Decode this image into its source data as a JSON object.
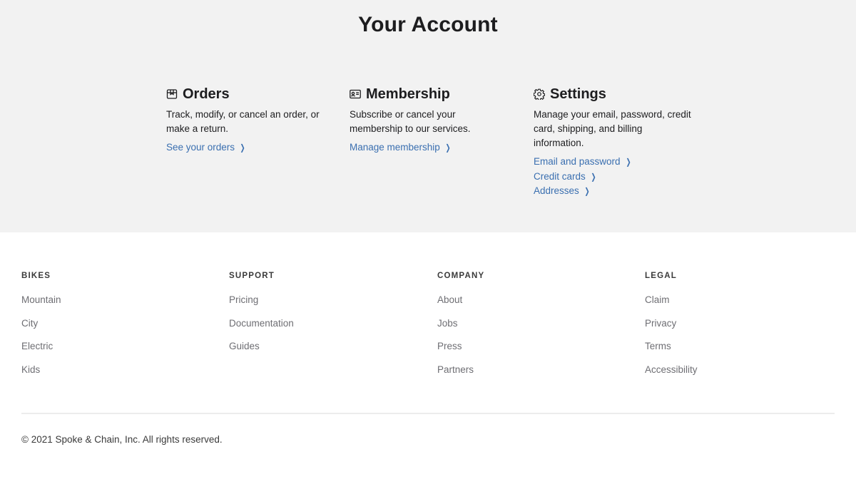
{
  "page": {
    "title": "Your Account"
  },
  "cards": [
    {
      "title": "Orders",
      "icon": "package-icon",
      "description": "Track, modify, or cancel an order, or make a return.",
      "links": [
        "See your orders"
      ]
    },
    {
      "title": "Membership",
      "icon": "id-card-icon",
      "description": "Subscribe or cancel your membership to our services.",
      "links": [
        "Manage membership"
      ]
    },
    {
      "title": "Settings",
      "icon": "gear-icon",
      "description": "Manage your email, password, credit card, shipping, and billing information.",
      "links": [
        "Email and password",
        "Credit cards",
        "Addresses"
      ]
    }
  ],
  "footer": {
    "columns": [
      {
        "heading": "BIKES",
        "links": [
          "Mountain",
          "City",
          "Electric",
          "Kids"
        ]
      },
      {
        "heading": "SUPPORT",
        "links": [
          "Pricing",
          "Documentation",
          "Guides"
        ]
      },
      {
        "heading": "COMPANY",
        "links": [
          "About",
          "Jobs",
          "Press",
          "Partners"
        ]
      },
      {
        "heading": "LEGAL",
        "links": [
          "Claim",
          "Privacy",
          "Terms",
          "Accessibility"
        ]
      }
    ],
    "copyright": "© 2021 Spoke & Chain, Inc. All rights reserved."
  },
  "colors": {
    "account_bg": "#f2f2f2",
    "link": "#3a6fb0",
    "footer_link": "#6e6e73"
  }
}
